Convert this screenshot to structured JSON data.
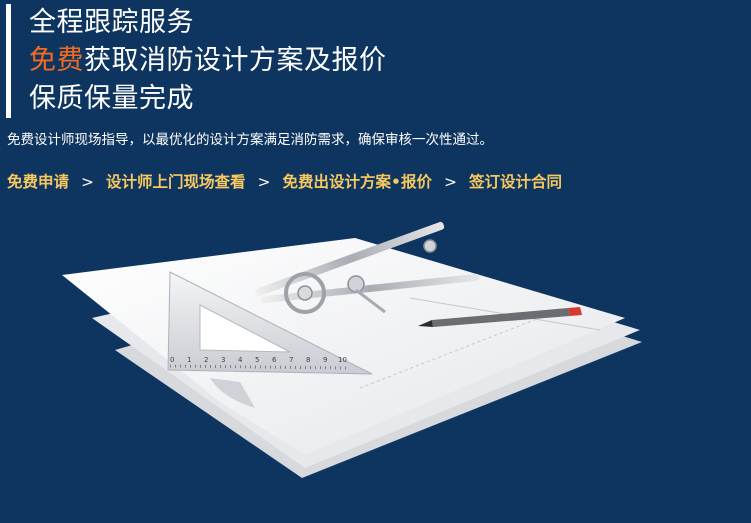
{
  "headline": {
    "line1": "全程跟踪服务",
    "line2_accent": "免费",
    "line2_rest": "获取消防设计方案及报价",
    "line3": "保质保量完成"
  },
  "description": "免费设计师现场指导，以最优化的设计方案满足消防需求，确保审核一次性通过。",
  "steps": [
    {
      "label": "免费申请"
    },
    {
      "label": "设计师上门现场查看"
    },
    {
      "label": "免费出设计方案•报价"
    },
    {
      "label": "签订设计合同"
    }
  ],
  "step_separator": ">",
  "ruler_ticks": [
    "0",
    "1",
    "2",
    "3",
    "4",
    "5",
    "6",
    "7",
    "8",
    "9",
    "10"
  ],
  "colors": {
    "background": "#0e3560",
    "accent": "#f26b21",
    "steps": "#f6c85f"
  }
}
